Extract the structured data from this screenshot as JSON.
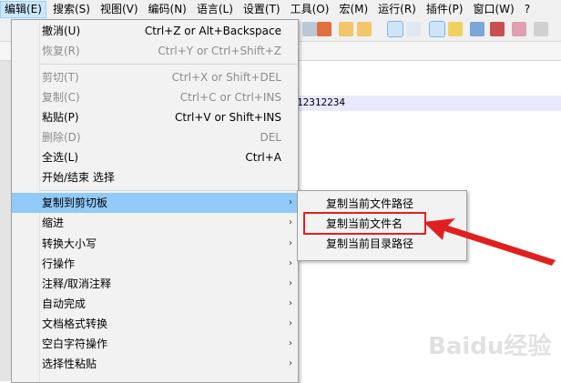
{
  "menubar": {
    "items": [
      "编辑(E)",
      "搜索(S)",
      "视图(V)",
      "编码(N)",
      "语言(L)",
      "设置(T)",
      "工具(O)",
      "宏(M)",
      "运行(R)",
      "插件(P)",
      "窗口(W)",
      "?"
    ]
  },
  "editor": {
    "text": "12312234",
    "tab_marker": "≥"
  },
  "edit_menu": {
    "groups": [
      [
        {
          "label": "撤消(U)",
          "shortcut": "Ctrl+Z or Alt+Backspace",
          "enabled": true
        },
        {
          "label": "恢复(R)",
          "shortcut": "Ctrl+Y or Ctrl+Shift+Z",
          "enabled": false
        }
      ],
      [
        {
          "label": "剪切(T)",
          "shortcut": "Ctrl+X or Shift+DEL",
          "enabled": false
        },
        {
          "label": "复制(C)",
          "shortcut": "Ctrl+C or Ctrl+INS",
          "enabled": false
        },
        {
          "label": "粘贴(P)",
          "shortcut": "Ctrl+V or Shift+INS",
          "enabled": true
        },
        {
          "label": "删除(D)",
          "shortcut": "DEL",
          "enabled": false
        },
        {
          "label": "全选(L)",
          "shortcut": "Ctrl+A",
          "enabled": true
        },
        {
          "label": "开始/结束 选择",
          "shortcut": "",
          "enabled": true
        }
      ],
      [
        {
          "label": "复制到剪切板",
          "submenu": true,
          "highlighted": true
        },
        {
          "label": "缩进",
          "submenu": true
        },
        {
          "label": "转换大小写",
          "submenu": true
        },
        {
          "label": "行操作",
          "submenu": true
        },
        {
          "label": "注释/取消注释",
          "submenu": true
        },
        {
          "label": "自动完成",
          "submenu": true
        },
        {
          "label": "文档格式转换",
          "submenu": true
        },
        {
          "label": "空白字符操作",
          "submenu": true
        },
        {
          "label": "选择性粘贴",
          "submenu": true
        }
      ]
    ],
    "submenu_arrow": "›"
  },
  "clipboard_submenu": {
    "items": [
      "复制当前文件路径",
      "复制当前文件名",
      "复制当前目录路径"
    ],
    "highlighted_index": 1
  },
  "annotation": {
    "color": "#e02020"
  },
  "watermark": "Baidu经验"
}
